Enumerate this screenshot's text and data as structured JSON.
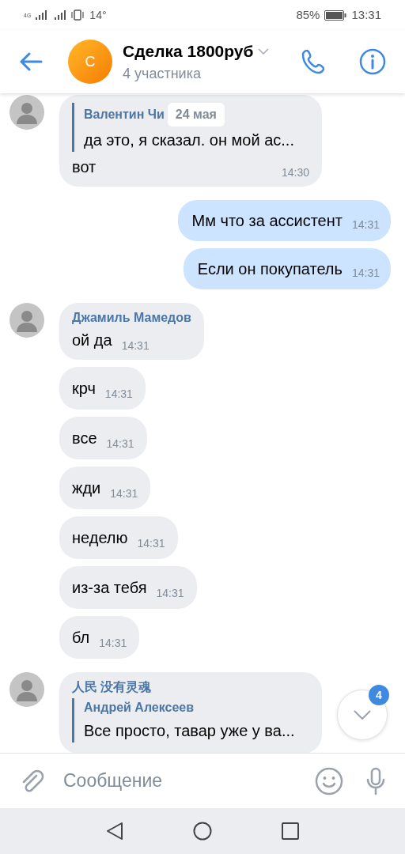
{
  "status_bar": {
    "network": "4G",
    "temperature": "14°",
    "battery": "85%",
    "time": "13:31"
  },
  "header": {
    "avatar_letter": "С",
    "title": "Сделка 1800руб",
    "subtitle": "4 участника"
  },
  "messages": [
    {
      "kind": "incoming",
      "avatar": true,
      "reply": {
        "name": "Валентин Чи",
        "text": "да это, я сказал. он мой ас..."
      },
      "date_pill": "24 мая",
      "text": "вот",
      "time": "14:30"
    },
    {
      "kind": "outgoing",
      "text": "Мм что за ассистент",
      "time": "14:31"
    },
    {
      "kind": "outgoing",
      "text": "Если он покупатель",
      "time": "14:31"
    },
    {
      "kind": "incoming",
      "avatar": true,
      "sender": "Джамиль Мамедов",
      "text": "ой да",
      "time": "14:31"
    },
    {
      "kind": "incoming",
      "avatar": false,
      "text": "крч",
      "time": "14:31"
    },
    {
      "kind": "incoming",
      "avatar": false,
      "text": "все",
      "time": "14:31"
    },
    {
      "kind": "incoming",
      "avatar": false,
      "text": "жди",
      "time": "14:31"
    },
    {
      "kind": "incoming",
      "avatar": false,
      "text": "неделю",
      "time": "14:31"
    },
    {
      "kind": "incoming",
      "avatar": false,
      "text": "из-за тебя",
      "time": "14:31"
    },
    {
      "kind": "incoming",
      "avatar": false,
      "text": "бл",
      "time": "14:31"
    },
    {
      "kind": "incoming",
      "avatar": true,
      "sender": "人民 没有灵魂",
      "reply": {
        "name": "Андрей Алексеев",
        "text": "Все просто, тавар уже у ва..."
      }
    }
  ],
  "scroll_down": {
    "badge": "4"
  },
  "composer": {
    "placeholder": "Сообщение"
  }
}
